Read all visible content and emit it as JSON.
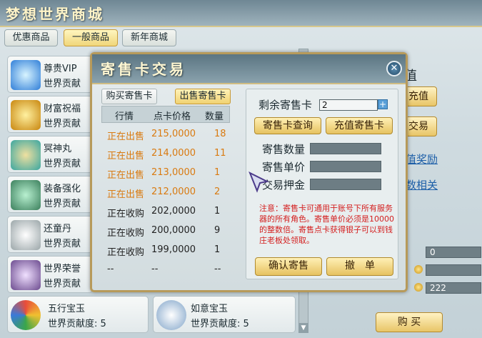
{
  "window": {
    "title": "梦想世界商城"
  },
  "tabs": [
    {
      "label": "优惠商品",
      "active": false
    },
    {
      "label": "一般商品",
      "active": true
    },
    {
      "label": "新年商城",
      "active": false
    }
  ],
  "items": [
    {
      "name": "尊贵VIP",
      "contrib": "世界贡献"
    },
    {
      "name": "财富祝福",
      "contrib": "世界贡献"
    },
    {
      "name": "冥神丸",
      "contrib": "世界贡献"
    },
    {
      "name": "装备强化",
      "contrib": "世界贡献"
    },
    {
      "name": "还童丹",
      "contrib": "世界贡献"
    },
    {
      "name": "世界荣誉",
      "contrib": "世界贡献"
    },
    {
      "name": "五行宝玉",
      "contrib": "世界贡献度: 5"
    },
    {
      "name": "如意宝玉",
      "contrib": "世界贡献度: 5"
    }
  ],
  "right_panel": {
    "heading_fragment": "值",
    "btn_recharge": "充值",
    "btn_trade": "交易",
    "link_reward": "值奖励",
    "link_related": "数相关",
    "stat_values": [
      "0",
      "",
      "222"
    ],
    "buy_button": "购 买"
  },
  "dialog": {
    "title": "寄售卡交易",
    "close_label": "✕",
    "tab_buy": "购买寄售卡",
    "tab_sell": "出售寄售卡",
    "table": {
      "headers": [
        "行情",
        "点卡价格",
        "数量"
      ],
      "rows": [
        {
          "status": "正在出售",
          "price": "215,0000",
          "qty": "18",
          "color": "#d97a10"
        },
        {
          "status": "正在出售",
          "price": "214,0000",
          "qty": "11",
          "color": "#d97a10"
        },
        {
          "status": "正在出售",
          "price": "213,0000",
          "qty": "1",
          "color": "#d97a10"
        },
        {
          "status": "正在出售",
          "price": "212,0000",
          "qty": "2",
          "color": "#d97a10"
        },
        {
          "status": "正在收购",
          "price": "202,0000",
          "qty": "1",
          "color": "#222222"
        },
        {
          "status": "正在收购",
          "price": "200,0000",
          "qty": "9",
          "color": "#222222"
        },
        {
          "status": "正在收购",
          "price": "199,0000",
          "qty": "1",
          "color": "#222222"
        },
        {
          "status": "--",
          "price": "--",
          "qty": "--",
          "color": "#222222"
        }
      ]
    },
    "remaining_label": "剩余寄售卡",
    "remaining_value": "2",
    "btn_query": "寄售卡查询",
    "btn_recharge_card": "充值寄售卡",
    "qty_label": "寄售数量",
    "price_label": "寄售单价",
    "deposit_label": "交易押金",
    "notice": "注意：寄售卡可通用于账号下所有服务器的所有角色。寄售单价必须是10000的整数倍。寄售点卡获得银子可以到钱庄老板处领取。",
    "btn_confirm": "确认寄售",
    "btn_cancel": "撤　单"
  }
}
